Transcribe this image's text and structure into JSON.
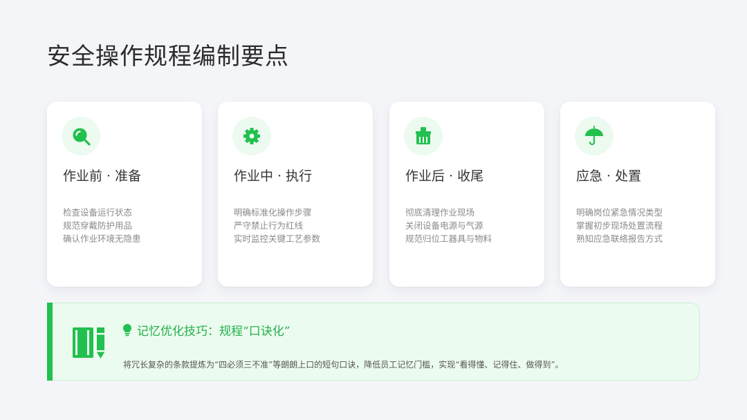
{
  "page": {
    "title": "安全操作规程编制要点"
  },
  "colors": {
    "accent": "#22c04f",
    "icon_bg": "#ecfaf0",
    "tip_bg": "#ecfbef",
    "tip_text": "#22b04a"
  },
  "cards": [
    {
      "icon": "search-icon",
      "title": "作业前 · 准备",
      "lines": [
        "检查设备运行状态",
        "规范穿戴防护用品",
        "确认作业环境无隐患"
      ]
    },
    {
      "icon": "gear-icon",
      "title": "作业中 · 执行",
      "lines": [
        "明确标准化操作步骤",
        "严守禁止行为红线",
        "实时监控关键工艺参数"
      ]
    },
    {
      "icon": "broom-icon",
      "title": "作业后 · 收尾",
      "lines": [
        "彻底清理作业现场",
        "关闭设备电源与气源",
        "规范归位工器具与物料"
      ]
    },
    {
      "icon": "umbrella-icon",
      "title": "应急 · 处置",
      "lines": [
        "明确岗位紧急情况类型",
        "掌握初步现场处置流程",
        "熟知应急联络报告方式"
      ]
    }
  ],
  "tip": {
    "icon": "notebook-pen-icon",
    "heading_icon": "lightbulb-icon",
    "heading": "记忆优化技巧：规程“口诀化”",
    "body": "将冗长复杂的条款提炼为“四必须三不准”等朗朗上口的短句口诀，降低员工记忆门槛，实现“看得懂、记得住、做得到”。"
  }
}
